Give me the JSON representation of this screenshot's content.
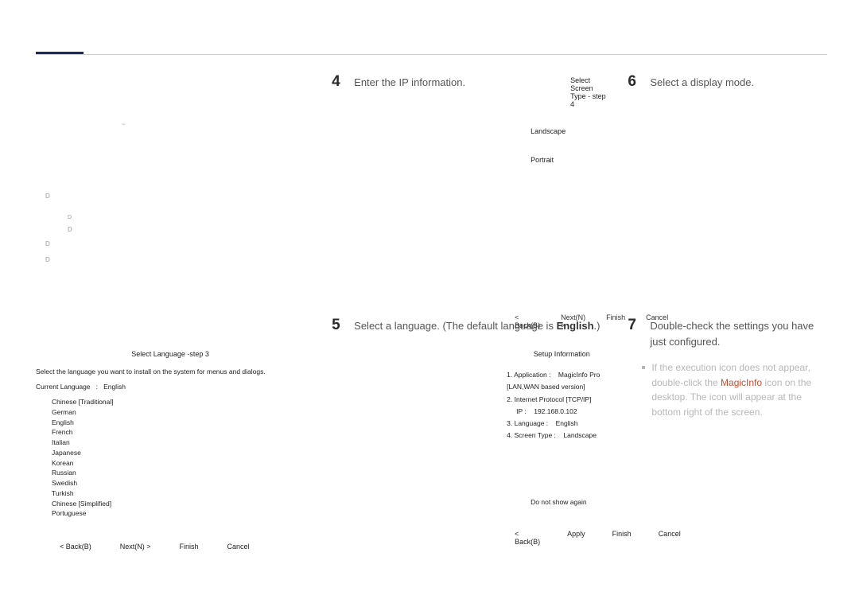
{
  "steps": {
    "s4": {
      "num": "4",
      "text": "Enter the IP information."
    },
    "s5": {
      "num": "5",
      "text_a": "Select a language. (The default language is ",
      "text_bold": "English",
      "text_b": ".)"
    },
    "s6": {
      "num": "6",
      "text": "Select a display mode."
    },
    "s7": {
      "num": "7",
      "text": "Double-check the settings you have just configured."
    }
  },
  "lang_panel": {
    "title": "Select Language -step 3",
    "desc": "Select the language you want to install on the system for menus and dialogs.",
    "current_label": "Current Language",
    "current_value": "English",
    "options": [
      "Chinese [Traditional]",
      "German",
      "English",
      "French",
      "Italian",
      "Japanese",
      "Korean",
      "Russian",
      "Swedish",
      "Turkish",
      "Chinese [Simplified]",
      "Portuguese"
    ]
  },
  "lang_btns": {
    "back": "< Back(B)",
    "next": "Next(N) >",
    "finish": "Finish",
    "cancel": "Cancel"
  },
  "screen_panel": {
    "title": "Select Screen Type - step 4",
    "opt1": "Landscape",
    "opt2": "Portrait"
  },
  "screen_btns": {
    "back": "< Back(B)",
    "next": "Next(N) >",
    "finish": "Finish",
    "cancel": "Cancel"
  },
  "setup_panel": {
    "title": "Setup Information",
    "line1_label": "1. Application :",
    "line1_value": "MagicInfo Pro [LAN,WAN based version]",
    "line2": "2. Internet Protocol [TCP/IP]",
    "ip_label": "IP :",
    "ip_value": "192.168.0.102",
    "line3_label": "3. Language :",
    "line3_value": "English",
    "line4_label": "4. Screen Type :",
    "line4_value": "Landscape",
    "noshow": "Do not show again"
  },
  "setup_btns": {
    "back": "< Back(B)",
    "apply": "Apply",
    "finish": "Finish",
    "cancel": "Cancel"
  },
  "note": {
    "pre": "If the execution icon does not appear, double-click the ",
    "brand": "MagicInfo",
    "post": " icon on the desktop. The icon will appear at the bottom right of the screen."
  },
  "faint": {
    "tilde": "~",
    "d": "D"
  }
}
